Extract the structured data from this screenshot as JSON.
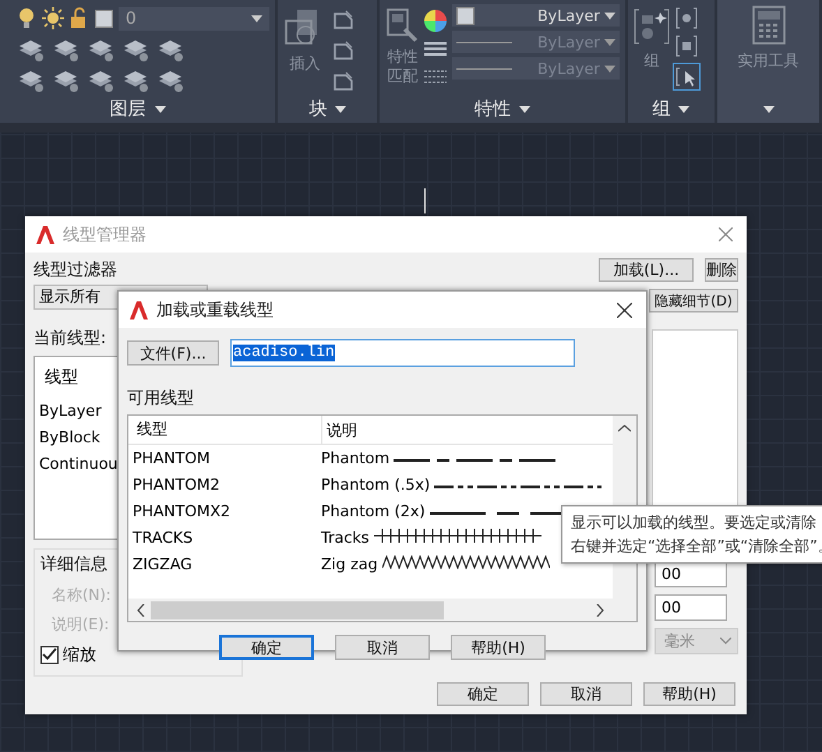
{
  "ribbon": {
    "layer_panel": {
      "current_layer": "0",
      "label": "图层"
    },
    "block_panel": {
      "insert_label": "插入",
      "label": "块"
    },
    "properties_panel": {
      "match_label": "特性匹配",
      "color_setting": "ByLayer",
      "linetype": "ByLayer",
      "lineweight": "ByLayer",
      "label": "特性"
    },
    "group_panel": {
      "group_label": "组",
      "label": "组"
    },
    "utilities_panel": {
      "label": "实用工具"
    }
  },
  "linetype_manager": {
    "title": "线型管理器",
    "filter_label": "线型过滤器",
    "filter_value": "显示所有",
    "buttons": [
      "加载(L)...",
      "删除",
      "隐藏细节(D)"
    ],
    "current_label": "当前线型:",
    "list": {
      "column": "线型",
      "rows": [
        "ByLayer",
        "ByBlock",
        "Continuou"
      ]
    },
    "details": {
      "label": "详细信息",
      "name_label": "名称(N):",
      "description_label": "说明(E):",
      "scale_checkbox": {
        "label": "缩放",
        "checked": true
      },
      "scale_values": [
        "00",
        "00"
      ],
      "units": {
        "value": "毫米",
        "disabled": true
      }
    },
    "footer_buttons": [
      "确定",
      "取消",
      "帮助(H)"
    ]
  },
  "load_dialog": {
    "title": "加载或重载线型",
    "file_button": "文件(F)...",
    "file_value": "acadiso.lin",
    "file_value_selected": true,
    "available_label": "可用线型",
    "columns": [
      "线型",
      "说明"
    ],
    "rows": [
      {
        "name": "PHANTOM",
        "description": "Phantom",
        "kind": "phantom"
      },
      {
        "name": "PHANTOM2",
        "description": "Phantom (.5x)",
        "kind": "phantom_half"
      },
      {
        "name": "PHANTOMX2",
        "description": "Phantom (2x)",
        "kind": "phantom_double"
      },
      {
        "name": "TRACKS",
        "description": "Tracks",
        "kind": "tracks"
      },
      {
        "name": "ZIGZAG",
        "description": "Zig zag",
        "kind": "zigzag"
      }
    ],
    "buttons": [
      {
        "label": "确定",
        "default": true
      },
      {
        "label": "取消",
        "default": false
      },
      {
        "label": "帮助(H)",
        "default": false
      }
    ]
  },
  "tooltip": {
    "lines": [
      "显示可以加载的线型。要选定或清除",
      "右键并选定“选择全部”或“清除全部”。"
    ]
  }
}
